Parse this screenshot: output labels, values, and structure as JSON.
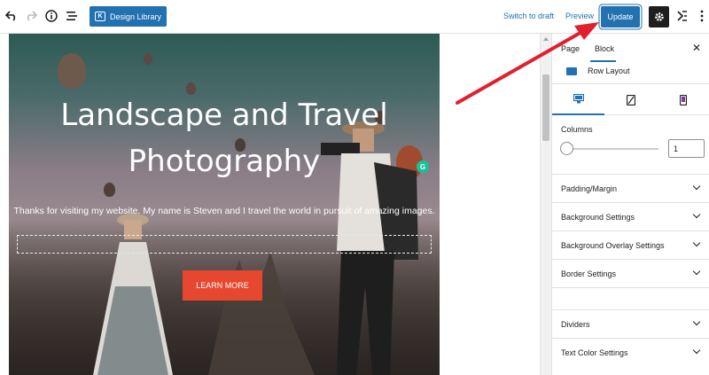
{
  "toolbar": {
    "design_library_label": "Design Library",
    "switch_to_draft_label": "Switch to draft",
    "preview_label": "Preview",
    "update_label": "Update"
  },
  "hero": {
    "title_line1": "Landscape and Travel",
    "title_line2": "Photography",
    "subtitle": "Thanks for visiting my website. My name is Steven and I travel the world in pursuit of amazing images.",
    "button_label": "LEARN MORE"
  },
  "sidebar": {
    "tab_page": "Page",
    "tab_block": "Block",
    "block_name": "Row Layout",
    "columns_label": "Columns",
    "columns_value": "1",
    "panels": [
      "Padding/Margin",
      "Background Settings",
      "Background Overlay Settings",
      "Border Settings",
      "Dividers",
      "Text Color Settings"
    ]
  },
  "colors": {
    "accent": "#2271b1",
    "button_red": "#e8472f",
    "arrow_red": "#e0202f"
  },
  "icons": [
    "undo-icon",
    "redo-icon",
    "info-icon",
    "list-view-icon",
    "settings-gear-icon",
    "kadence-icon",
    "more-options-icon",
    "close-icon",
    "desktop-icon",
    "tablet-icon",
    "mobile-icon",
    "grammarly-icon"
  ]
}
